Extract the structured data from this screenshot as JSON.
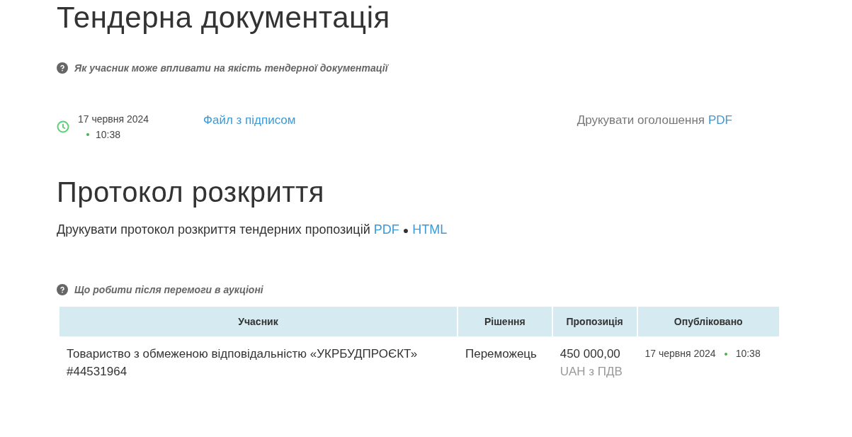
{
  "title": "Тендерна документація",
  "help_link": "Як учасник може впливати на якість тендерної документації",
  "document": {
    "date": "17 червня 2024",
    "time": "10:38",
    "file_link": "Файл з підписом",
    "print_label": "Друкувати оголошення",
    "print_link": "PDF"
  },
  "protocol": {
    "title": "Протокол розкриття",
    "print_label": "Друкувати протокол розкриття тендерних пропозицій",
    "links": [
      "PDF",
      "HTML"
    ],
    "separator": "●"
  },
  "help_link_2": "Що робити після перемоги в аукціоні",
  "table": {
    "columns": [
      "Учасник",
      "Рішення",
      "Пропозиція",
      "Опубліковано"
    ],
    "rows": [
      {
        "participant": "Товариство з обмеженою відповідальністю «УКРБУДПРОЄКТ»",
        "code": "#44531964",
        "decision": "Переможець",
        "amount": "450 000,00",
        "currency": "UAH з ПДВ",
        "date": "17 червня 2024",
        "time": "10:38"
      }
    ]
  }
}
